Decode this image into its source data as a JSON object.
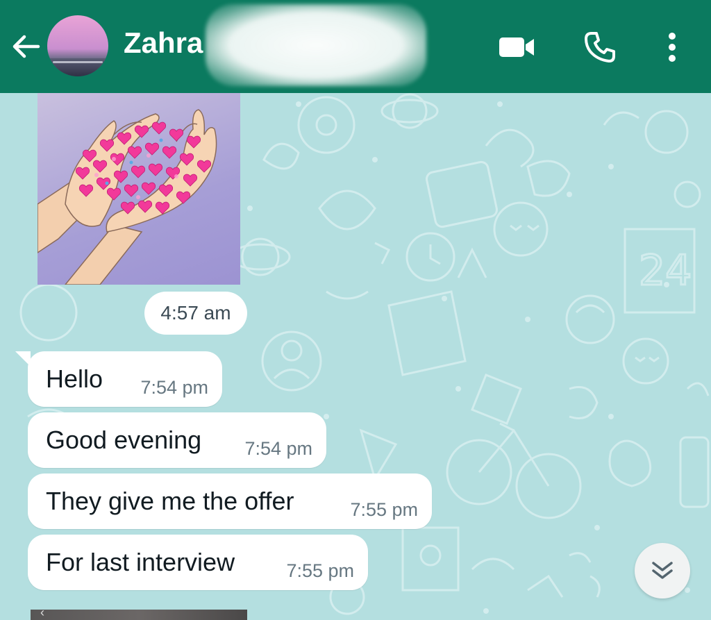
{
  "header": {
    "back_icon": "arrow-left-icon",
    "contact_name": "Zahra",
    "video_icon": "video-camera-icon",
    "call_icon": "phone-icon",
    "menu_icon": "more-vertical-icon",
    "background_color": "#0b7a5f"
  },
  "chat": {
    "wallpaper_color": "#b4dfe0",
    "image_message": {
      "time": "4:57 am"
    },
    "messages": [
      {
        "text": "Hello",
        "time": "7:54 pm"
      },
      {
        "text": "Good evening",
        "time": "7:54 pm"
      },
      {
        "text": "They give me the offer",
        "time": "7:55 pm"
      },
      {
        "text": "For last interview",
        "time": "7:55 pm"
      }
    ]
  },
  "scroll_button": {
    "icon": "double-chevron-down-icon"
  }
}
